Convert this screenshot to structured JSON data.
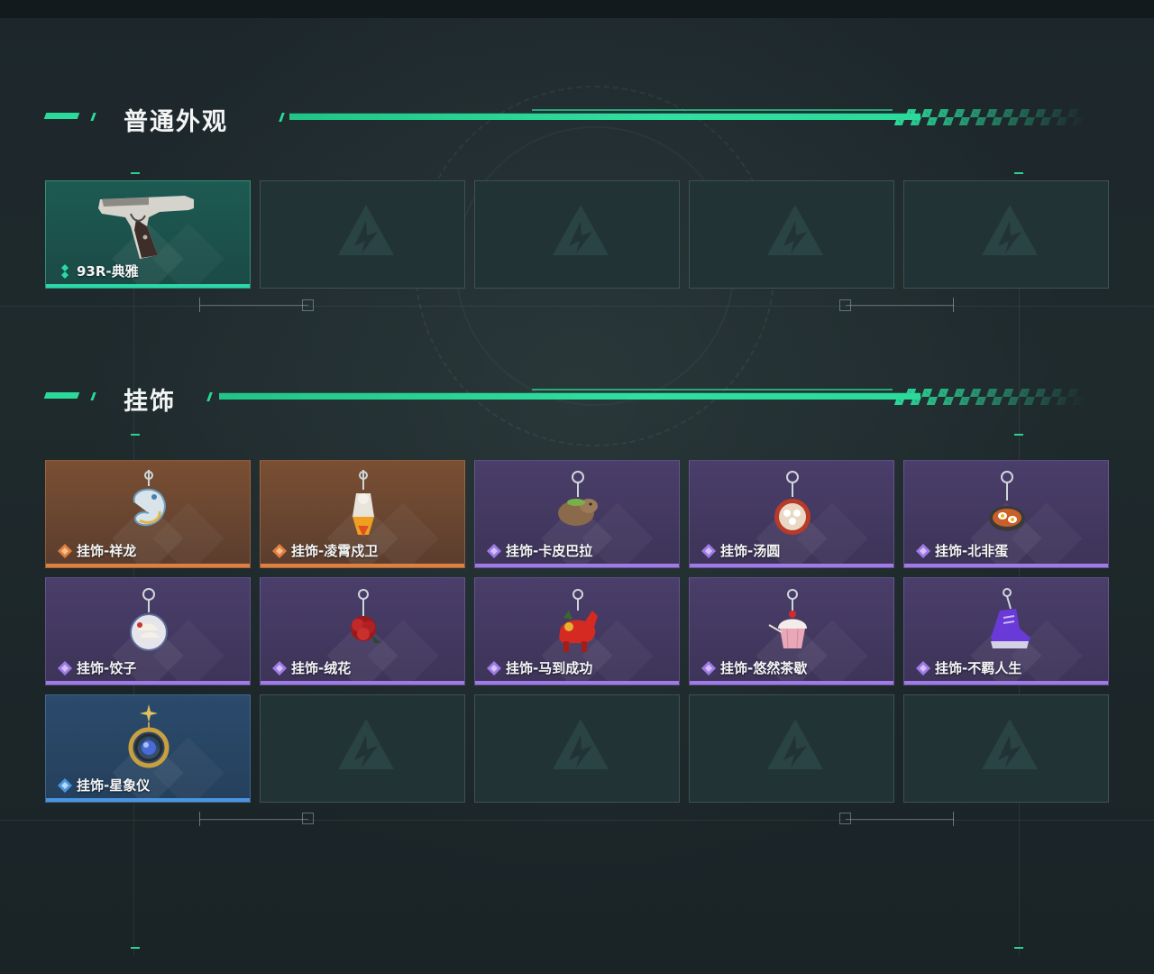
{
  "sections": [
    {
      "title": "普通外观",
      "items": [
        {
          "label": "93R-典雅",
          "rarity": "teal",
          "icon": "pistol-icon"
        },
        {
          "label": "",
          "rarity": "empty"
        },
        {
          "label": "",
          "rarity": "empty"
        },
        {
          "label": "",
          "rarity": "empty"
        },
        {
          "label": "",
          "rarity": "empty"
        }
      ]
    },
    {
      "title": "挂饰",
      "items": [
        {
          "label": "挂饰-祥龙",
          "rarity": "orange",
          "icon": "dragon-charm-icon"
        },
        {
          "label": "挂饰-凌霄戍卫",
          "rarity": "orange",
          "icon": "guardian-charm-icon"
        },
        {
          "label": "挂饰-卡皮巴拉",
          "rarity": "purple",
          "icon": "capybara-charm-icon"
        },
        {
          "label": "挂饰-汤圆",
          "rarity": "purple",
          "icon": "tangyuan-charm-icon"
        },
        {
          "label": "挂饰-北非蛋",
          "rarity": "purple",
          "icon": "shakshuka-charm-icon"
        },
        {
          "label": "挂饰-饺子",
          "rarity": "purple",
          "icon": "dumpling-charm-icon"
        },
        {
          "label": "挂饰-绒花",
          "rarity": "purple",
          "icon": "velvet-flower-charm-icon"
        },
        {
          "label": "挂饰-马到成功",
          "rarity": "purple",
          "icon": "horse-charm-icon"
        },
        {
          "label": "挂饰-悠然茶歇",
          "rarity": "purple",
          "icon": "cupcake-charm-icon"
        },
        {
          "label": "挂饰-不羁人生",
          "rarity": "purple",
          "icon": "sneaker-charm-icon"
        },
        {
          "label": "挂饰-星象仪",
          "rarity": "blue",
          "icon": "astrolabe-charm-icon"
        },
        {
          "label": "",
          "rarity": "empty"
        },
        {
          "label": "",
          "rarity": "empty"
        },
        {
          "label": "",
          "rarity": "empty"
        },
        {
          "label": "",
          "rarity": "empty"
        }
      ]
    }
  ],
  "colors": {
    "accent": "#2bd99a",
    "teal": "#2bd9a8",
    "orange": "#e07f3e",
    "purple": "#a07ae8",
    "blue": "#4a95e0"
  }
}
